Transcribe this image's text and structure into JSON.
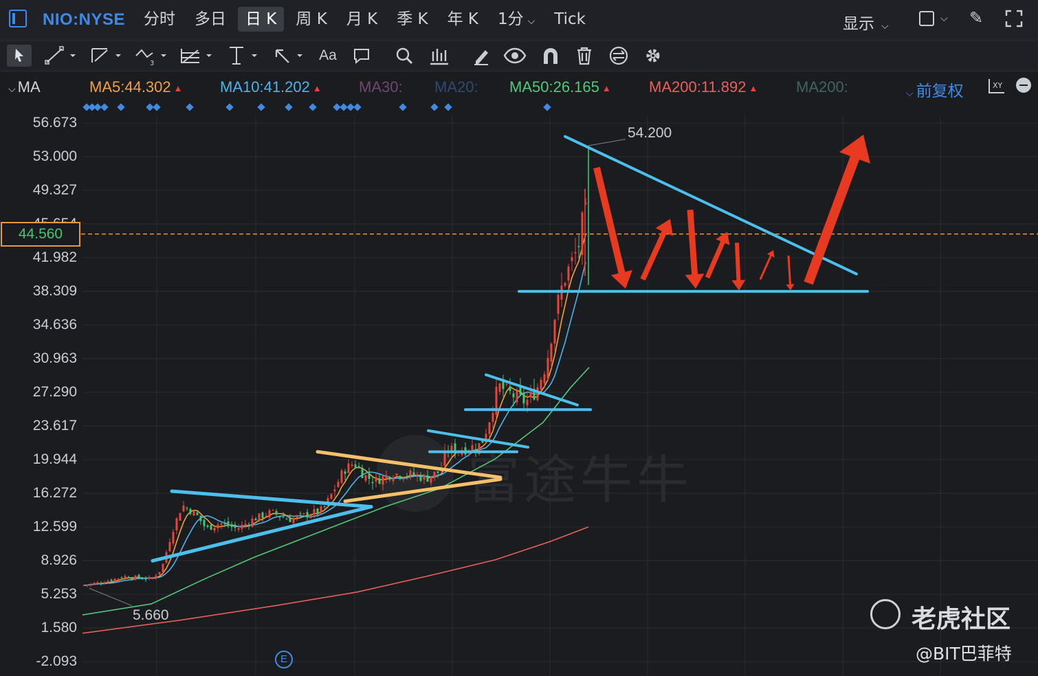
{
  "header": {
    "symbol": "NIO:NYSE",
    "tabs": [
      {
        "label": "分时"
      },
      {
        "label": "多日"
      },
      {
        "label": "日 K",
        "active": true
      },
      {
        "label": "周 K"
      },
      {
        "label": "月 K"
      },
      {
        "label": "季 K"
      },
      {
        "label": "年 K"
      },
      {
        "label": "1分",
        "has_dropdown": true
      },
      {
        "label": "Tick"
      }
    ],
    "display_menu": "显示"
  },
  "toolbar": {
    "font_tool_label": "Aa",
    "icons": [
      "cursor-icon",
      "line-tool-icon",
      "channel-tool-icon",
      "wave-tool-icon",
      "fib-tool-icon",
      "vertical-line-icon",
      "arrow-tool-icon",
      "text-tool-icon",
      "comment-icon",
      "zoom-icon",
      "indicator-icon",
      "pen-icon",
      "eye-icon",
      "magnet-icon",
      "trash-icon",
      "sync-icon",
      "settings-icon"
    ]
  },
  "ma_bar": {
    "indicator": "MA",
    "items": [
      {
        "label": "MA5:44.302",
        "color": "#f0a040",
        "arrow": true
      },
      {
        "label": "MA10:41.202",
        "color": "#4fb3ea",
        "arrow": true
      },
      {
        "label": "MA30:",
        "color": "#6b4a6e",
        "arrow": false
      },
      {
        "label": "MA20:",
        "color": "#2f4a70",
        "arrow": false
      },
      {
        "label": "MA50:26.165",
        "color": "#52c878",
        "arrow": true
      },
      {
        "label": "MA200:11.892",
        "color": "#e8605a",
        "arrow": true
      },
      {
        "label": "MA200:",
        "color": "#3f6560",
        "arrow": false
      }
    ],
    "adjustment": "前复权"
  },
  "y_axis": {
    "ticks": [
      "56.673",
      "53.000",
      "49.327",
      "45.654",
      "41.982",
      "38.309",
      "34.636",
      "30.963",
      "27.290",
      "23.617",
      "19.944",
      "16.272",
      "12.599",
      "8.926",
      "5.253",
      "1.580",
      "-2.093"
    ],
    "current_price": "44.560"
  },
  "annotations": {
    "high_label": "54.200",
    "low_label": "5.660",
    "event_badge": "E"
  },
  "watermark": {
    "app_name": "富途牛牛",
    "community": "老虎社区",
    "author": "@BIT巴菲特"
  },
  "colors": {
    "up": "#e8453a",
    "down": "#43c872",
    "trendline_blue": "#4cc0ec",
    "trendline_yellow": "#f5c06a",
    "arrow_red": "#e83a20",
    "accent": "#3e8be6"
  },
  "chart_data": {
    "type": "candlestick",
    "y_range": [
      -2.093,
      56.673
    ],
    "high": 54.2,
    "low": 5.66,
    "current_price": 44.56
  }
}
